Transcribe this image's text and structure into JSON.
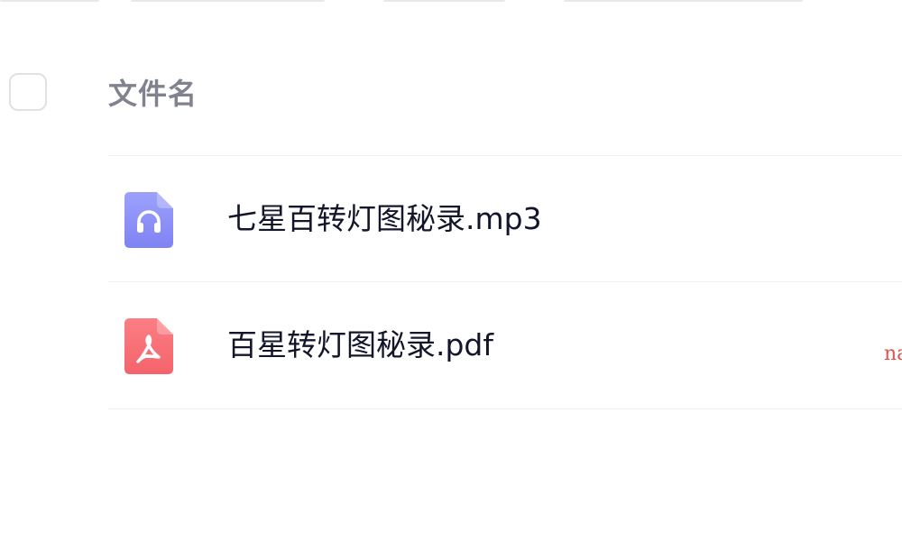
{
  "file_list": {
    "header": {
      "name_column": "文件名"
    },
    "files": [
      {
        "name": "七星百转灯图秘录.mp3",
        "type_icon": "audio-file-icon",
        "color": "#8b8ff8"
      },
      {
        "name": "百星转灯图秘录.pdf",
        "type_icon": "pdf-file-icon",
        "color": "#f86b72"
      }
    ]
  },
  "watermark": {
    "text": "na"
  },
  "colors": {
    "header_text": "#80838d",
    "file_text": "#13162b",
    "divider": "#eef0f3",
    "watermark": "#e0524d"
  }
}
